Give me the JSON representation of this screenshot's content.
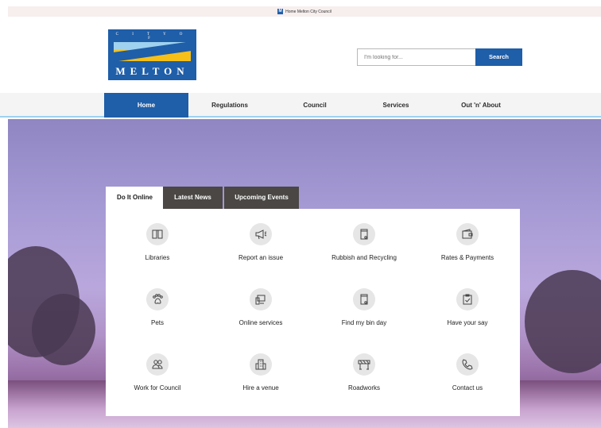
{
  "browser": {
    "tab_title": "Home Melton City Council",
    "favicon_letter": "M"
  },
  "logo": {
    "city_text": "C I T Y O F",
    "name_text": "MELTON"
  },
  "search": {
    "placeholder": "I'm looking for...",
    "button_label": "Search"
  },
  "nav": {
    "items": [
      "Home",
      "Regulations",
      "Council",
      "Services",
      "Out 'n' About"
    ],
    "active": "Home"
  },
  "tabs": {
    "items": [
      "Do It Online",
      "Latest News",
      "Upcoming Events"
    ],
    "active": "Do It Online"
  },
  "services": [
    {
      "label": "Libraries",
      "icon": "book-icon"
    },
    {
      "label": "Report an issue",
      "icon": "megaphone-icon"
    },
    {
      "label": "Rubbish and Recycling",
      "icon": "bin-icon"
    },
    {
      "label": "Rates & Payments",
      "icon": "wallet-icon"
    },
    {
      "label": "Pets",
      "icon": "paw-icon"
    },
    {
      "label": "Online services",
      "icon": "devices-icon"
    },
    {
      "label": "Find my bin day",
      "icon": "bin-icon"
    },
    {
      "label": "Have your say",
      "icon": "clipboard-icon"
    },
    {
      "label": "Work for Council",
      "icon": "people-icon"
    },
    {
      "label": "Hire a venue",
      "icon": "building-icon"
    },
    {
      "label": "Roadworks",
      "icon": "barrier-icon"
    },
    {
      "label": "Contact us",
      "icon": "phone-icon"
    }
  ],
  "colors": {
    "brand_blue": "#1f5ea8",
    "accent_yellow": "#f6c019",
    "light_blue": "#9ed2ef",
    "tab_dark": "#4a4744"
  }
}
